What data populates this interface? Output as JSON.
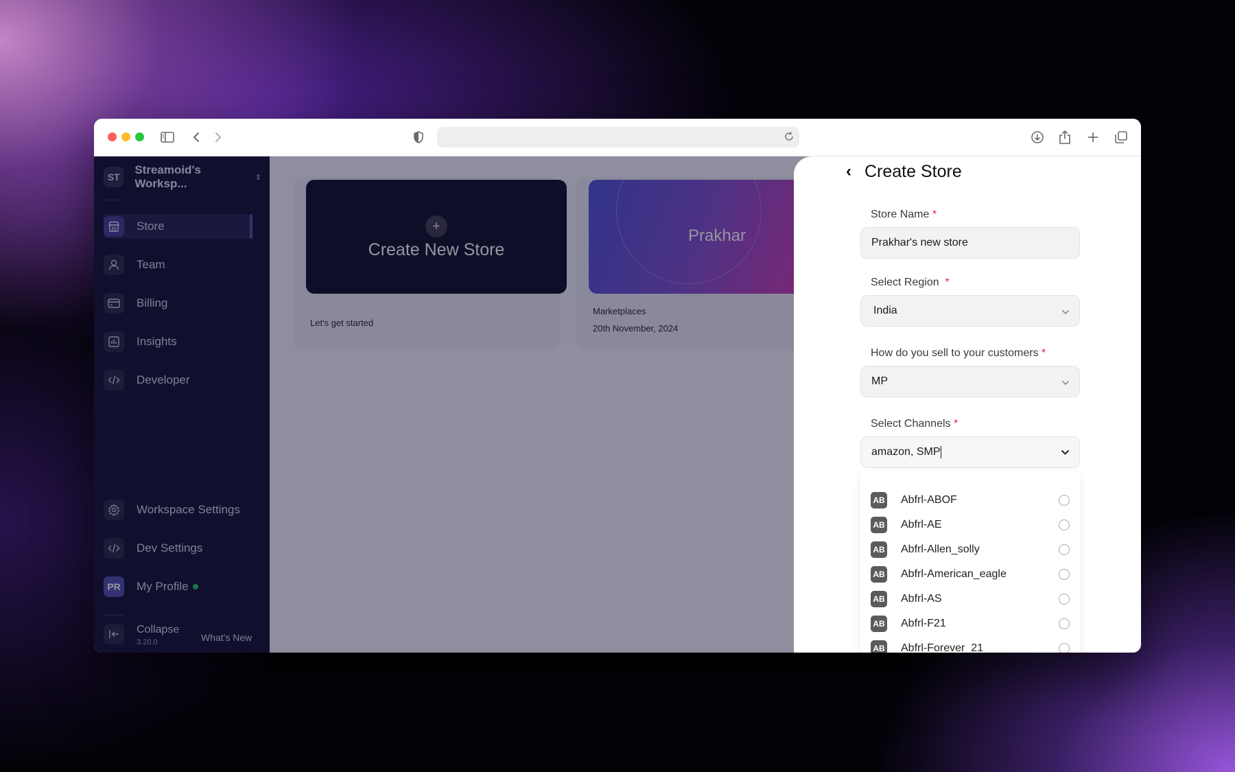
{
  "workspace": {
    "initials": "ST",
    "name": "Streamoid's Worksp..."
  },
  "sidebar": {
    "items": [
      {
        "label": "Store",
        "icon": "store-icon"
      },
      {
        "label": "Team",
        "icon": "team-icon"
      },
      {
        "label": "Billing",
        "icon": "billing-icon"
      },
      {
        "label": "Insights",
        "icon": "insights-icon"
      },
      {
        "label": "Developer",
        "icon": "code-icon"
      }
    ],
    "bottom": [
      {
        "label": "Workspace Settings",
        "icon": "gear-icon"
      },
      {
        "label": "Dev Settings",
        "icon": "code-icon"
      }
    ],
    "profile": {
      "initials": "PR",
      "label": "My Profile"
    },
    "collapse": {
      "label": "Collapse",
      "version": "3.20.0",
      "whats_new": "What's New"
    }
  },
  "cards": {
    "create": {
      "plus": "+",
      "title": "Create New Store",
      "caption": "Let's get started"
    },
    "store": {
      "title": "Prakhar",
      "type": "Marketplaces",
      "date": "20th November, 2024"
    }
  },
  "panel": {
    "back": "‹",
    "title": "Create Store",
    "store_name": {
      "label": "Store Name",
      "value": "Prakhar's new store"
    },
    "region": {
      "label": "Select Region",
      "value": "India"
    },
    "sell": {
      "label": "How do you sell to your customers",
      "value": "MP"
    },
    "channels": {
      "label": "Select Channels",
      "value": "amazon, SMP"
    },
    "required_mark": "*",
    "options": [
      {
        "badge": "AB",
        "label": "Abfrl-ABOF"
      },
      {
        "badge": "AB",
        "label": "Abfrl-AE"
      },
      {
        "badge": "AB",
        "label": "Abfrl-Allen_solly"
      },
      {
        "badge": "AB",
        "label": "Abfrl-American_eagle"
      },
      {
        "badge": "AB",
        "label": "Abfrl-AS"
      },
      {
        "badge": "AB",
        "label": "Abfrl-F21"
      },
      {
        "badge": "AB",
        "label": "Abfrl-Forever_21"
      }
    ]
  },
  "colors": {
    "sidebar_bg": "#0e0b2a",
    "active_accent": "#4b4ba8",
    "online_dot": "#22c55e",
    "required": "#e0245e"
  }
}
